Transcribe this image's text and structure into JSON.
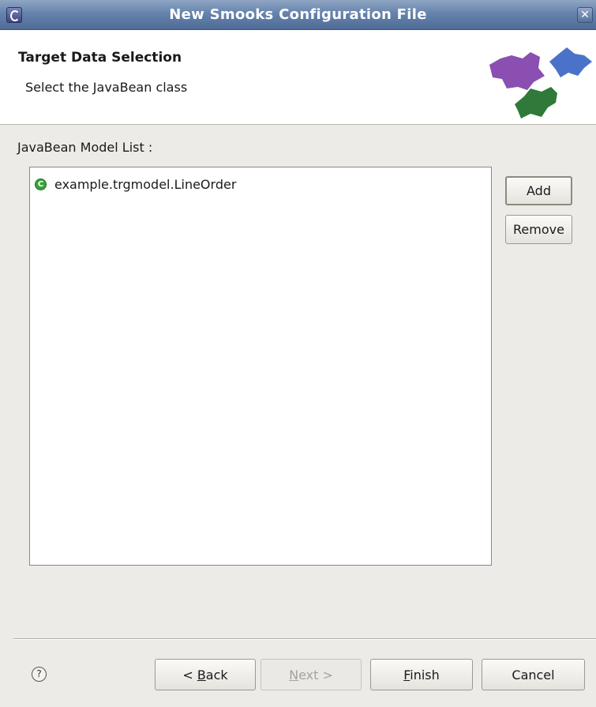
{
  "window": {
    "title": "New Smooks Configuration File",
    "close_glyph": "✕"
  },
  "banner": {
    "title": "Target Data Selection",
    "description": "Select the JavaBean class",
    "logo_icon": "puzzle-pieces-logo"
  },
  "list": {
    "label": "JavaBean Model List :",
    "items": [
      {
        "label": "example.trgmodel.LineOrder",
        "icon": "class-icon",
        "icon_color": "#3aa23a"
      }
    ]
  },
  "side_buttons": {
    "add": "Add",
    "remove": "Remove"
  },
  "footer": {
    "help_glyph": "?",
    "back": {
      "prefix": "< ",
      "mnemonic": "B",
      "rest": "ack"
    },
    "next": {
      "mnemonic": "N",
      "rest": "ext >"
    },
    "finish": {
      "mnemonic": "F",
      "rest": "inish"
    },
    "cancel": "Cancel"
  },
  "colors": {
    "titlebar": "#5f7aa6",
    "dialog_bg": "#edebe7",
    "logo_purple": "#8a4fb0",
    "logo_blue": "#4a72c9",
    "logo_green": "#2f7a3a"
  }
}
